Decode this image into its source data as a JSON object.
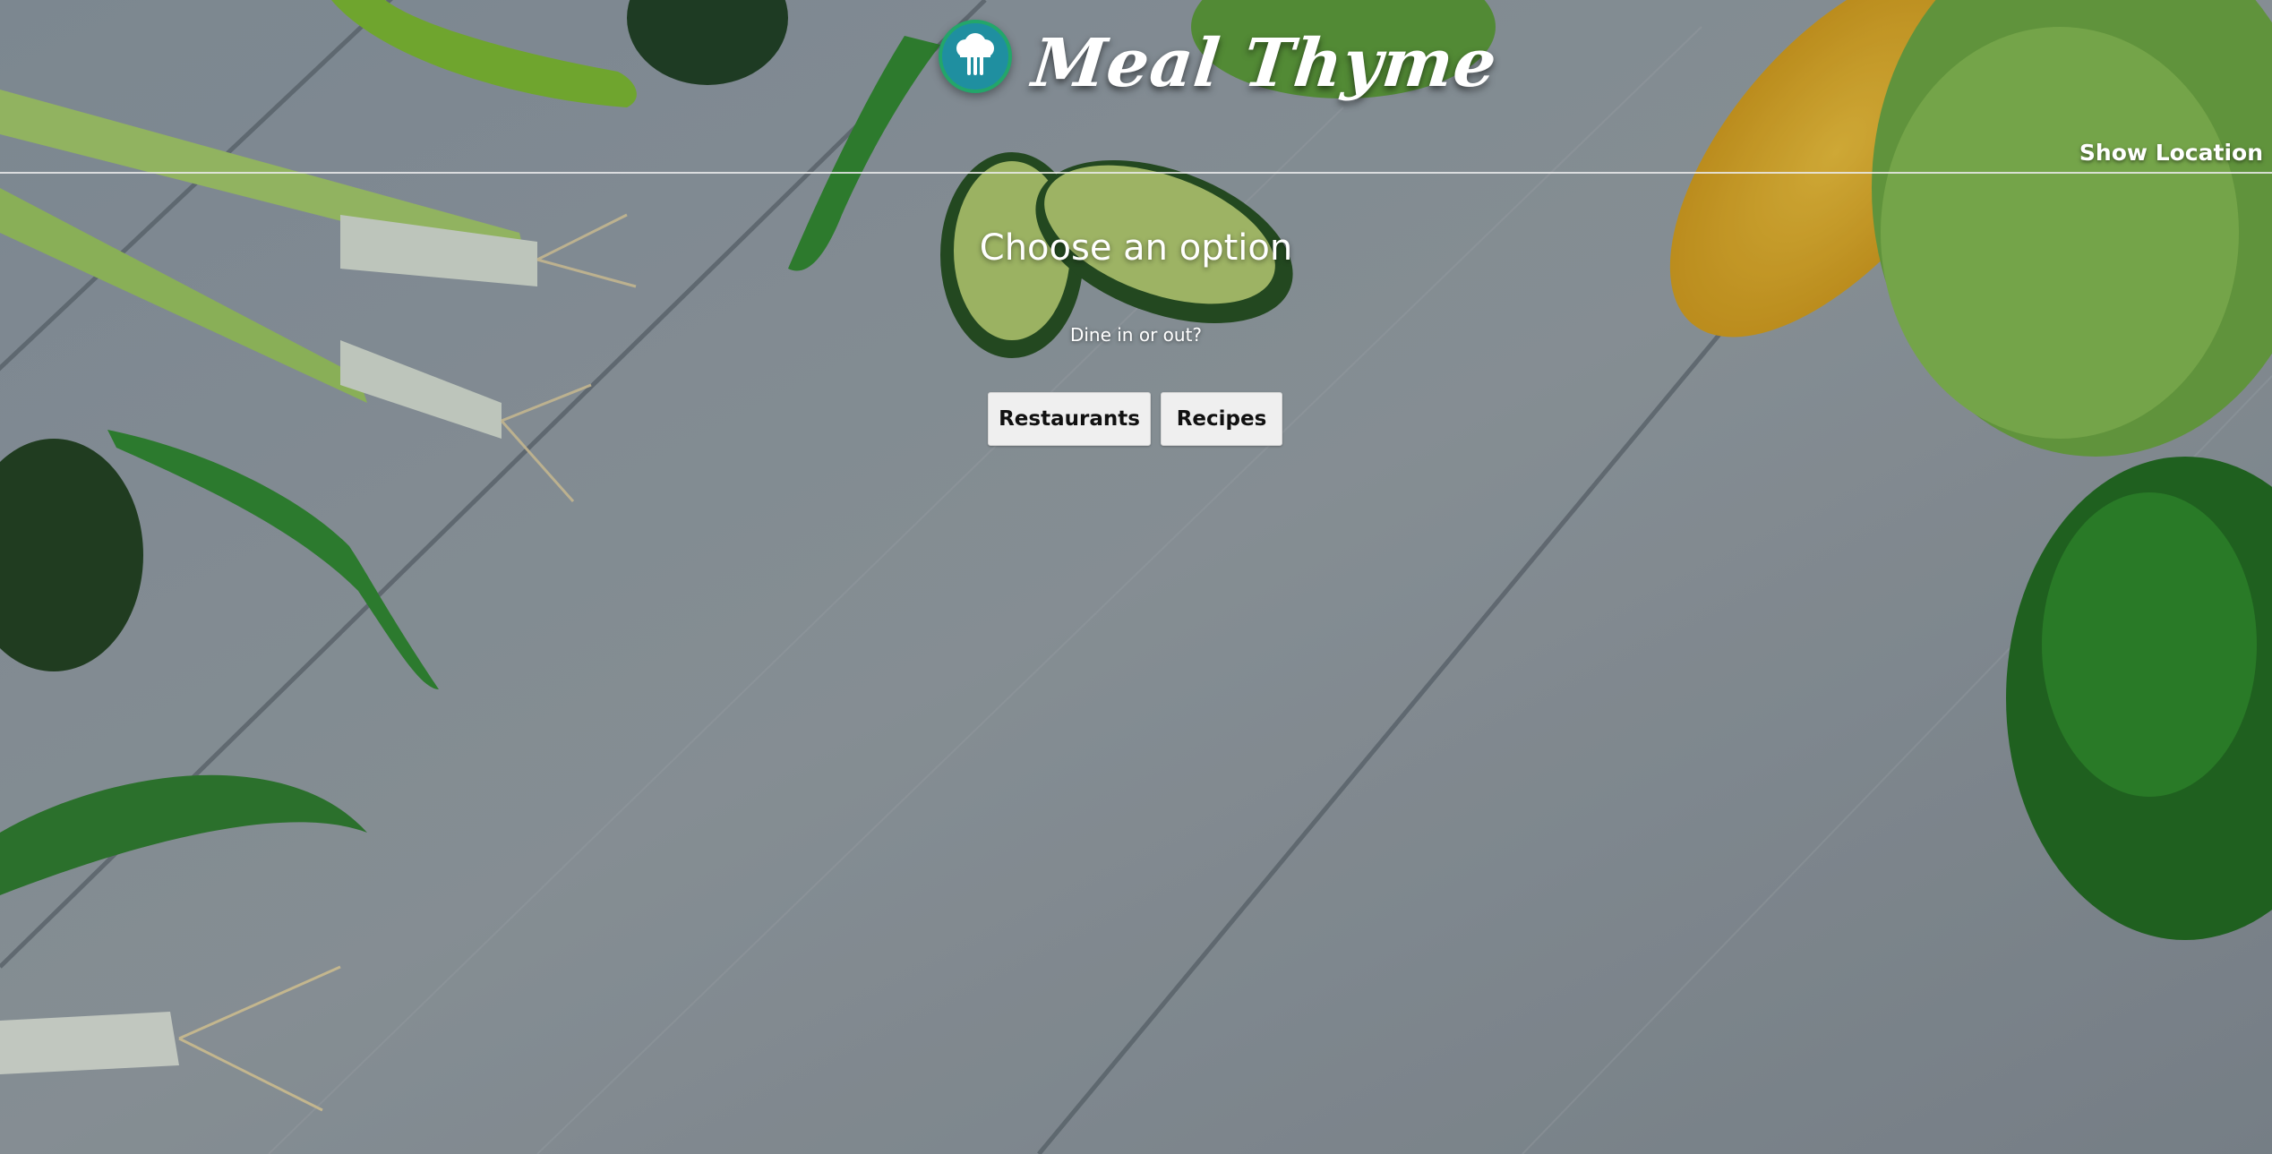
{
  "header": {
    "brand_name": "Meal Thyme",
    "logo_icon": "chef-hat-cutlery-icon",
    "show_location_label": "Show Location"
  },
  "main": {
    "title": "Choose an option",
    "subtitle": "Dine in or out?",
    "buttons": {
      "restaurants_label": "Restaurants",
      "recipes_label": "Recipes"
    }
  },
  "colors": {
    "logo_fill": "#1f8fa0",
    "logo_ring": "#23a66a",
    "button_bg": "#efefef",
    "text_light": "#ffffff"
  }
}
